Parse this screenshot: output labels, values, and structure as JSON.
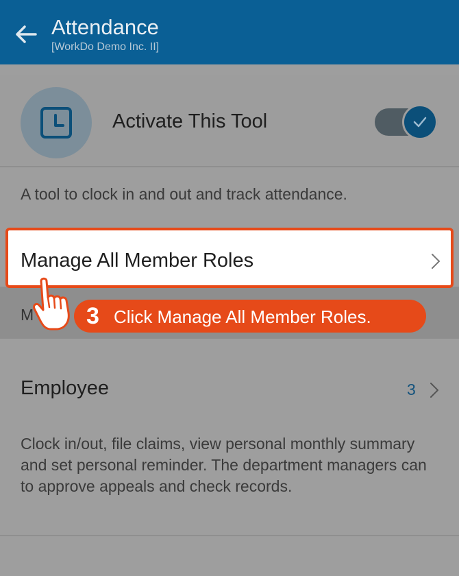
{
  "header": {
    "title": "Attendance",
    "subtitle": "[WorkDo Demo Inc. II]",
    "back_icon": "arrow-left-icon"
  },
  "tool": {
    "label": "Activate This Tool",
    "icon": "clock-square-icon",
    "toggle_on": true
  },
  "description": "A tool to clock in and out and track attendance.",
  "manage": {
    "label": "Manage All Member Roles"
  },
  "strip": {
    "partial_text": "M"
  },
  "tutorial": {
    "step": "3",
    "text": "Click Manage All Member Roles."
  },
  "roles": [
    {
      "name": "Employee",
      "count": "3",
      "description": "Clock in/out, file claims, view personal monthly summary and set personal reminder. The department managers can to approve appeals and check records."
    }
  ],
  "colors": {
    "appbar": "#0a5f95",
    "accent": "#e64a19",
    "link": "#14537d"
  }
}
